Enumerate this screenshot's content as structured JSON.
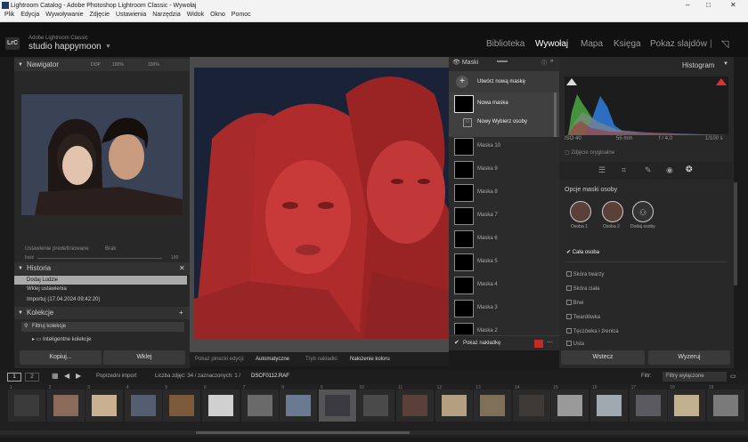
{
  "window": {
    "title": "Lightroom Catalog - Adobe Photoshop Lightroom Classic - Wywołaj"
  },
  "menu": [
    "Plik",
    "Edycja",
    "Wywoływanie",
    "Zdjęcie",
    "Ustawienia",
    "Narzędzia",
    "Widok",
    "Okno",
    "Pomoc"
  ],
  "identity": {
    "app": "Adobe Lightroom Classic",
    "studio": "studio happymoon",
    "logo": "LrC"
  },
  "modules": [
    "Biblioteka",
    "Wywołaj",
    "Mapa",
    "Księga",
    "Pokaz slajdów"
  ],
  "navigator": {
    "title": "Nawigator",
    "zoom": [
      "DOP",
      "100%",
      "100%"
    ]
  },
  "presets": {
    "label": "Ustawienie predefiniowane",
    "value": "Brak",
    "left": "Ilość",
    "right": "100"
  },
  "history": {
    "title": "Historia",
    "items": [
      "Dodaj Ludzie",
      "Wklej ustawienia",
      "Importuj (17.04.2024 09:42:20)"
    ]
  },
  "collections": {
    "title": "Kolekcje",
    "filter": "Filtruj kolekcje",
    "smart": "Inteligentne kolekcje"
  },
  "left_buttons": {
    "copy": "Kopiuj...",
    "paste": "Wklej"
  },
  "masks": {
    "title": "Maski",
    "create": "Utwórz nową maskę",
    "new_mask": "Nowa maska",
    "new_select": "Nowy Wybierz osoby",
    "list": [
      "Maska 10",
      "Maska 9",
      "Maska 8",
      "Maska 7",
      "Maska 6",
      "Maska 5",
      "Maska 4",
      "Maska 3",
      "Maska 2"
    ],
    "overlay": "Pokaż nakładkę"
  },
  "toolbar": {
    "label1": "Pokaż pinezki edycji:",
    "value1": "Automatyczne",
    "label2": "Tryb nakładki:",
    "value2": "Nałożenie koloru"
  },
  "histogram": {
    "title": "Histogram",
    "iso": "ISO 40",
    "focal": "55 mm",
    "aperture": "f / 4,0",
    "shutter": "1/100 s",
    "original": "Zdjęcie oryginalne"
  },
  "person_options": {
    "title": "Opcje maski osoby",
    "people": [
      "Osoba 1",
      "Osoba 2",
      "Dodaj osoby"
    ],
    "whole": "Cała osoba",
    "parts": [
      "Skóra twarzy",
      "Skóra ciała",
      "Brwi",
      "Twardówka",
      "Tęczówka i źrenica",
      "Usta"
    ]
  },
  "right_buttons": {
    "back": "Wstecz",
    "reset": "Wyzeruj"
  },
  "filmstrip": {
    "pages": [
      "1",
      "2"
    ],
    "source": "Poprzedni import",
    "count": "Liczba zdjęć: 34 / zaznaczonych: 1 /",
    "file": "DSCF0112.RAF",
    "filter_label": "Filtr:",
    "filter_value": "Filtry wyłączone",
    "numbers": [
      "1",
      "2",
      "3",
      "4",
      "5",
      "6",
      "7",
      "8",
      "9",
      "10",
      "11",
      "12",
      "13",
      "14",
      "15",
      "16",
      "17",
      "18",
      "19"
    ]
  },
  "colors": {
    "overlay": "#c02b2b",
    "active_module": "#ffffff"
  }
}
